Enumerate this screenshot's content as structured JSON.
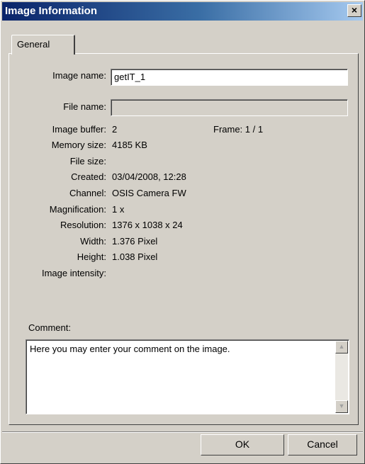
{
  "window": {
    "title": "Image Information",
    "close_glyph": "×"
  },
  "tabs": [
    {
      "label": "General"
    }
  ],
  "fields": {
    "image_name": {
      "label": "Image name:",
      "value": "getIT_1"
    },
    "file_name": {
      "label": "File name:",
      "value": ""
    }
  },
  "info": {
    "image_buffer": {
      "label": "Image buffer:",
      "value": "2"
    },
    "frame": {
      "text": "Frame: 1 / 1"
    },
    "memory_size": {
      "label": "Memory size:",
      "value": "4185 KB"
    },
    "file_size": {
      "label": "File size:",
      "value": ""
    },
    "created": {
      "label": "Created:",
      "value": "03/04/2008, 12:28"
    },
    "channel": {
      "label": "Channel:",
      "value": "OSIS Camera FW"
    },
    "magnification": {
      "label": "Magnification:",
      "value": "1 x"
    },
    "resolution": {
      "label": "Resolution:",
      "value": "1376 x 1038 x 24"
    },
    "width": {
      "label": "Width:",
      "value": "1.376 Pixel"
    },
    "height": {
      "label": "Height:",
      "value": "1.038 Pixel"
    },
    "image_intensity": {
      "label": "Image intensity:",
      "value": ""
    }
  },
  "comment": {
    "label": "Comment:",
    "value": "Here you may enter your comment on the image."
  },
  "buttons": {
    "ok": "OK",
    "cancel": "Cancel"
  },
  "colors": {
    "titlebar_start": "#0a246a",
    "titlebar_end": "#a6caf0",
    "dialog_face": "#d4d0c8"
  }
}
